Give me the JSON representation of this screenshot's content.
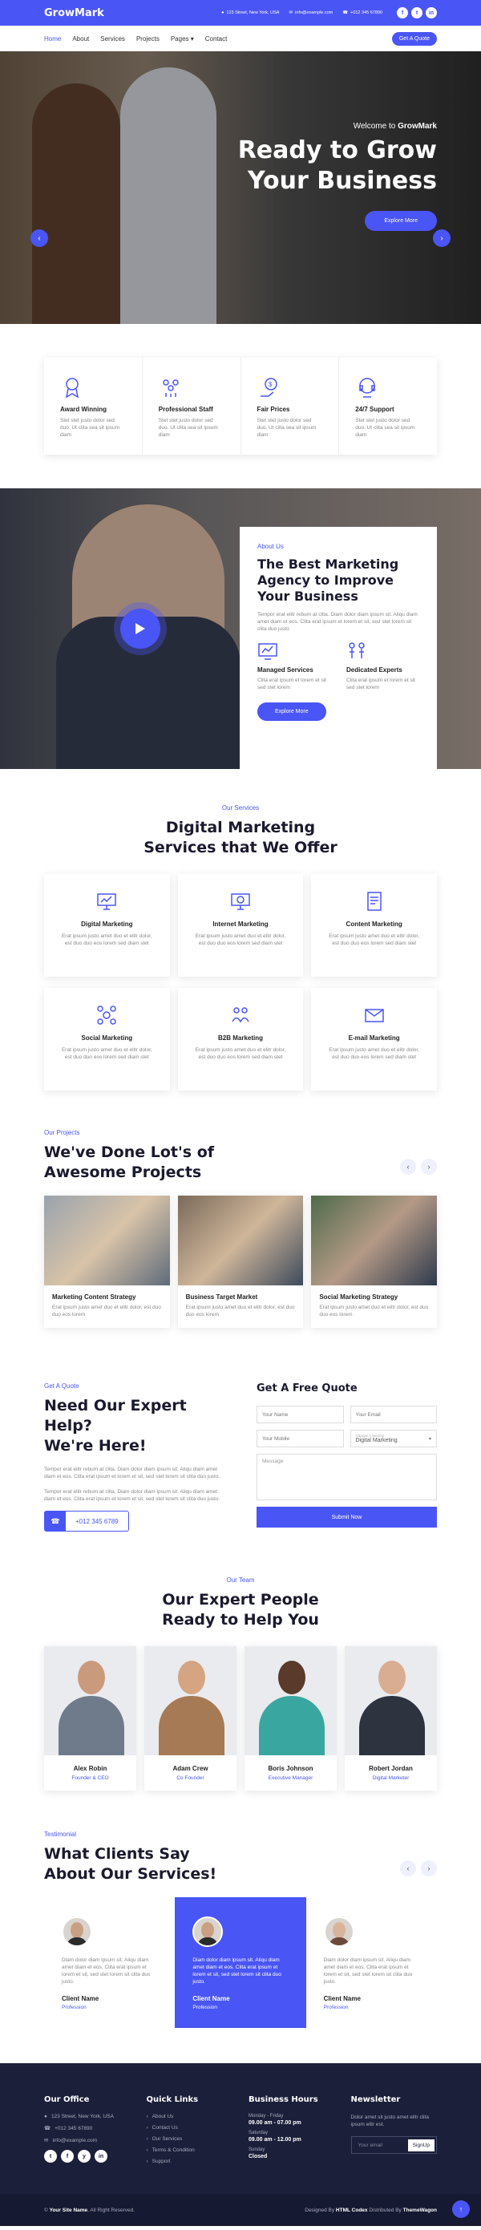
{
  "brand": {
    "name": "GrowMark",
    "accent": "#4a55f5",
    "dark": "#1b1f3a"
  },
  "topbar": {
    "address": "123 Street, New York, USA",
    "email": "info@example.com",
    "phone": "+012 345 67890",
    "social": [
      "f",
      "t",
      "in"
    ]
  },
  "nav": {
    "items": [
      "Home",
      "About",
      "Services",
      "Projects",
      "Pages"
    ],
    "contact": "Contact",
    "quote_button": "Get A Quote"
  },
  "hero": {
    "welcome_prefix": "Welcome to",
    "welcome_brand": "GrowMark",
    "title_line1": "Ready to Grow",
    "title_line2": "Your Business",
    "button": "Explore More"
  },
  "features": [
    {
      "title": "Award Winning",
      "desc": "Stet stet justo dolor sed duo. Ut clita sea sit ipsum diam",
      "icon": "award-icon"
    },
    {
      "title": "Professional Staff",
      "desc": "Stet stet justo dolor sed duo. Ut clita sea sit ipsum diam",
      "icon": "team-icon"
    },
    {
      "title": "Fair Prices",
      "desc": "Stet stet justo dolor sed duo. Ut clita sea sit ipsum diam",
      "icon": "price-icon"
    },
    {
      "title": "24/7 Support",
      "desc": "Stet stet justo dolor sed duo. Ut clita sea sit ipsum diam",
      "icon": "support-icon"
    }
  ],
  "about": {
    "tag": "About Us",
    "title": "The Best Marketing Agency to Improve Your Business",
    "desc": "Tempor erat elitr rebum at clita. Diam dolor diam ipsum sit. Aliqu diam amet diam et eos. Clita erat ipsum et lorem et sit, sed stet lorem sit clita duo justo",
    "items": [
      {
        "title": "Managed Services",
        "desc": "Clita erat ipsum et lorem et sit sed stet lorem"
      },
      {
        "title": "Dedicated Experts",
        "desc": "Clita erat ipsum et lorem et sit sed stet lorem"
      }
    ],
    "button": "Explore More"
  },
  "services": {
    "tag": "Our Services",
    "title_line1": "Digital Marketing",
    "title_line2": "Services that We Offer",
    "items": [
      {
        "title": "Digital Marketing",
        "desc": "Erat ipsum justo amet duo et elitr dolor, est duo duo eos lorem sed diam stet"
      },
      {
        "title": "Internet Marketing",
        "desc": "Erat ipsum justo amet duo et elitr dolor, est duo duo eos lorem sed diam stet"
      },
      {
        "title": "Content Marketing",
        "desc": "Erat ipsum justo amet duo et elitr dolor, est duo duo eos lorem sed diam stet"
      },
      {
        "title": "Social Marketing",
        "desc": "Erat ipsum justo amet duo et elitr dolor, est duo duo eos lorem sed diam stet"
      },
      {
        "title": "B2B Marketing",
        "desc": "Erat ipsum justo amet duo et elitr dolor, est duo duo eos lorem sed diam stet"
      },
      {
        "title": "E-mail Marketing",
        "desc": "Erat ipsum justo amet duo et elitr dolor, est duo duo eos lorem sed diam stet"
      }
    ]
  },
  "projects": {
    "tag": "Our Projects",
    "title_line1": "We've Done Lot's of",
    "title_line2": "Awesome Projects",
    "items": [
      {
        "title": "Marketing Content Strategy",
        "desc": "Erat ipsum justo amet duo et elitr dolor, est duo duo eos lorem"
      },
      {
        "title": "Business Target Market",
        "desc": "Erat ipsum justo amet duo et elitr dolor, est duo duo eos lorem"
      },
      {
        "title": "Social Marketing Strategy",
        "desc": "Erat ipsum justo amet duo et elitr dolor, est duo duo eos lorem"
      }
    ]
  },
  "quote": {
    "tag": "Get A Quote",
    "title_line1": "Need Our Expert Help?",
    "title_line2": "We're Here!",
    "p1": "Tempor erat elitr rebum at clita. Diam dolor diam ipsum sit. Aliqu diam amet diam et eos. Clita erat ipsum et lorem et sit, sed stet lorem sit clita duo justo.",
    "p2": "Tempor erat elitr rebum at clita. Diam dolor diam ipsum sit. Aliqu diam amet diam et eos. Clita erat ipsum et lorem et sit, sed stet lorem sit clita duo justo.",
    "phone": "+012 345 6789",
    "form": {
      "title": "Get A Free Quote",
      "name_ph": "Your Name",
      "email_ph": "Your Email",
      "mobile_ph": "Your Mobile",
      "service_label": "Choose A Service",
      "service_value": "Digital Marketing",
      "message_ph": "Message",
      "submit": "Submit Now"
    }
  },
  "team": {
    "tag": "Our Team",
    "title_line1": "Our Expert People",
    "title_line2": "Ready to Help You",
    "members": [
      {
        "name": "Alex Robin",
        "role": "Founder & CEO"
      },
      {
        "name": "Adam Crew",
        "role": "Co Founder"
      },
      {
        "name": "Boris Johnson",
        "role": "Executive Manager"
      },
      {
        "name": "Robert Jordan",
        "role": "Digital Marketer"
      }
    ]
  },
  "testimonial": {
    "tag": "Testimonial",
    "title_line1": "What Clients Say",
    "title_line2": "About Our Services!",
    "items": [
      {
        "quote": "Diam dolor diam ipsum sit. Aliqu diam amet diam et eos. Clita erat ipsum et lorem et sit, sed stet lorem sit clita duo justo.",
        "name": "Client Name",
        "role": "Profession"
      },
      {
        "quote": "Diam dolor diam ipsum sit. Aliqu diam amet diam et eos. Clita erat ipsum et lorem et sit, sed stet lorem sit clita duo justo.",
        "name": "Client Name",
        "role": "Profession"
      },
      {
        "quote": "Diam dolor diam ipsum sit. Aliqu diam amet diam et eos. Clita erat ipsum et lorem et sit, sed stet lorem sit clita duo justo.",
        "name": "Client Name",
        "role": "Profession"
      }
    ]
  },
  "footer": {
    "office_title": "Our Office",
    "address": "123 Street, New York, USA",
    "phone": "+012 345 67890",
    "email": "info@example.com",
    "social": [
      "t",
      "f",
      "y",
      "in"
    ],
    "links_title": "Quick Links",
    "links": [
      "About Us",
      "Contact Us",
      "Our Services",
      "Terms & Condition",
      "Support"
    ],
    "hours_title": "Business Hours",
    "hours": [
      {
        "label": "Monday - Friday",
        "value": "09.00 am - 07.00 pm"
      },
      {
        "label": "Saturday",
        "value": "09.00 am - 12.00 pm"
      },
      {
        "label": "Sunday",
        "value": "Closed"
      }
    ],
    "newsletter_title": "Newsletter",
    "newsletter_desc": "Dolor amet sit justo amet elitr clita ipsum elitr est.",
    "newsletter_ph": "Your email",
    "newsletter_btn": "SignUp"
  },
  "copyright": {
    "site": "Your Site Name",
    "rights": ", All Right Reserved.",
    "designed_prefix": "Designed By",
    "designer": "HTML Codex",
    "distributed_prefix": "Distributed By",
    "distributor": "ThemeWagon"
  }
}
